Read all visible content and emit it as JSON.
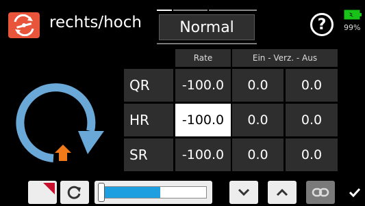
{
  "header": {
    "title": "rechts/hoch",
    "phase_name": "Normal",
    "help_symbol": "?",
    "battery_percent": "99%",
    "app_icon": "helicopter-servo-icon"
  },
  "table": {
    "columns": [
      "Rate",
      "Ein - Verz. - Aus"
    ],
    "rows": [
      {
        "label": "QR",
        "rate": "-100.0",
        "ein": "0.0",
        "aus": "0.0"
      },
      {
        "label": "HR",
        "rate": "-100.0",
        "ein": "0.0",
        "aus": "0.0"
      },
      {
        "label": "SR",
        "rate": "-100.0",
        "ein": "0.0",
        "aus": "0.0"
      }
    ],
    "selected_row": "HR",
    "selected_column": "Rate"
  },
  "illustration": {
    "icon": "clockwise-rotation-arrow-icon",
    "arrow_color": "#6aa8d8",
    "marker_color": "#f07a1a"
  },
  "toolbar": {
    "slider_fill": 0.55,
    "buttons": [
      "reset-corner-icon",
      "refresh-icon",
      "slider",
      "chevron-down-icon",
      "chevron-up-icon",
      "link-icon",
      "checkmark-icon"
    ]
  },
  "colors": {
    "accent": "#e8553b",
    "cell_bg": "#2e2e2e",
    "selected_bg": "#ffffff",
    "slider_blue": "#1e9fe0"
  }
}
